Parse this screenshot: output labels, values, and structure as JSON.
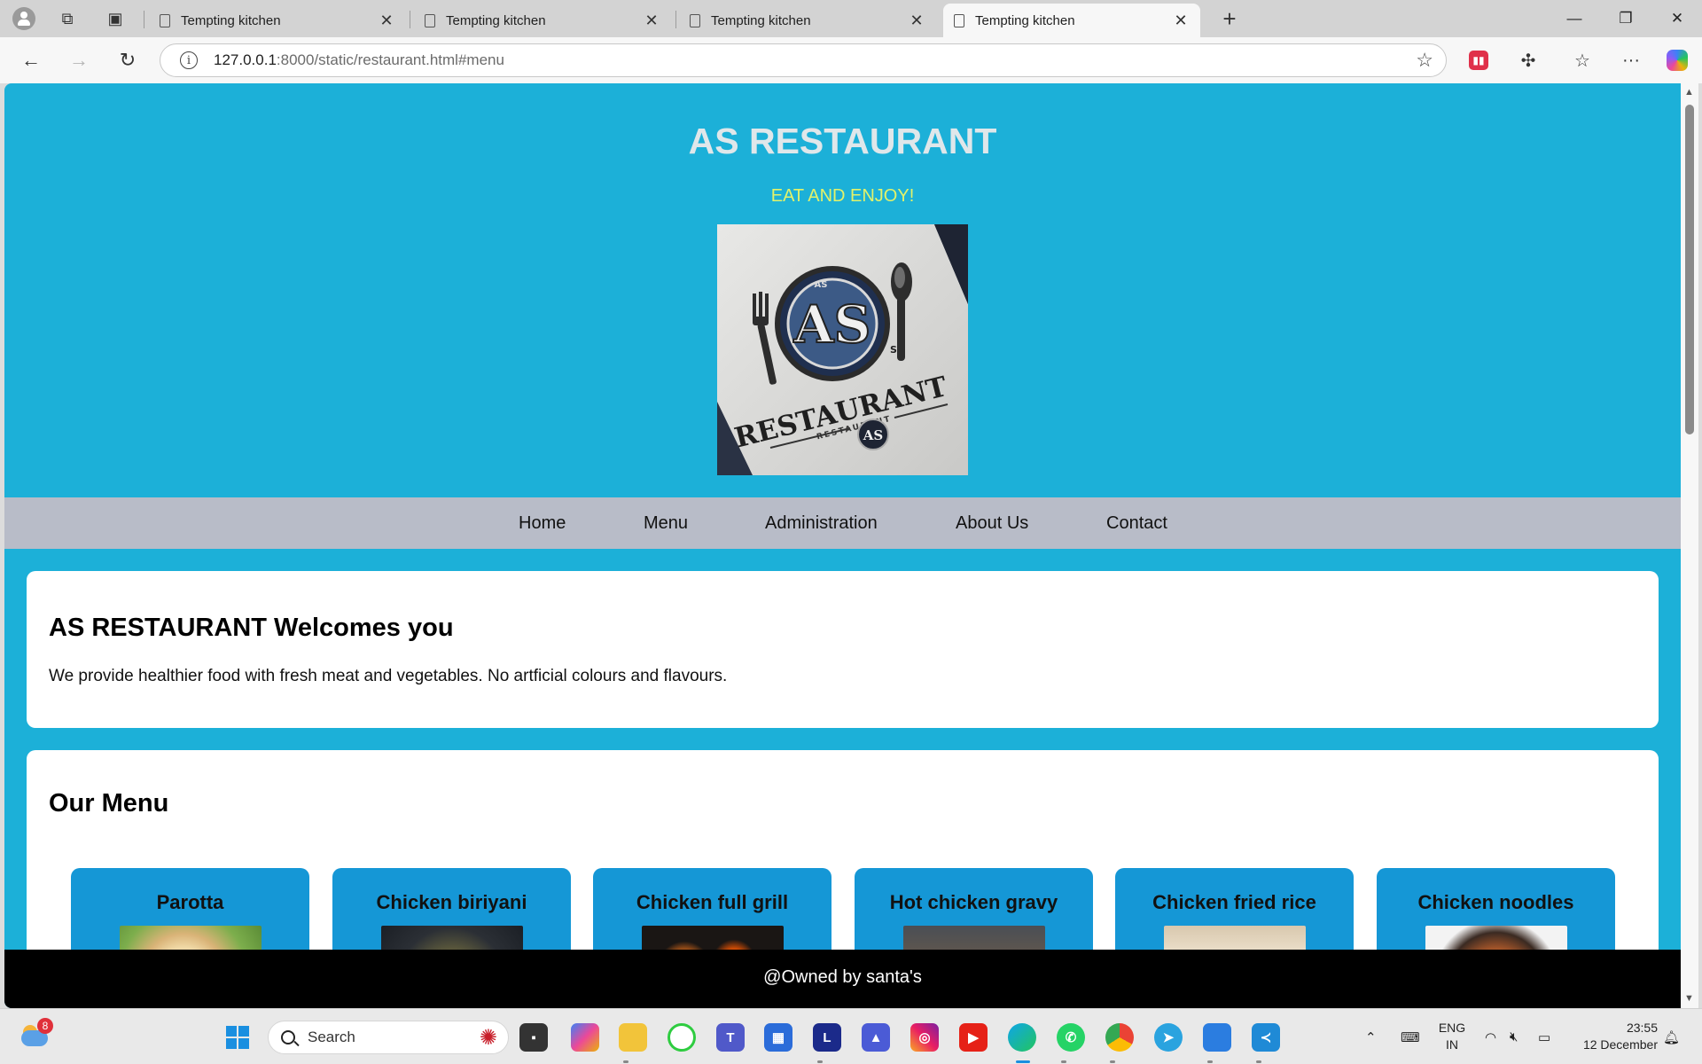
{
  "browser": {
    "tabs": [
      {
        "title": "Tempting kitchen",
        "active": false
      },
      {
        "title": "Tempting kitchen",
        "active": false
      },
      {
        "title": "Tempting kitchen",
        "active": false
      },
      {
        "title": "Tempting kitchen",
        "active": true
      }
    ],
    "url_host": "127.0.0.1",
    "url_rest": ":8000/static/restaurant.html#menu"
  },
  "page": {
    "site_title": "AS RESTAURANT",
    "tagline": "EAT AND ENJOY!",
    "logo": {
      "text_initials": "AS",
      "text_main": "RESTAURANT",
      "text_small": "RESTAURANT",
      "text_top": "AS",
      "text_side": "S"
    },
    "nav": [
      "Home",
      "Menu",
      "Administration",
      "About Us",
      "Contact"
    ],
    "welcome": {
      "heading": "AS RESTAURANT Welcomes you",
      "text": "We provide healthier food with fresh meat and vegetables. No artficial colours and flavours."
    },
    "menu": {
      "heading": "Our Menu",
      "items": [
        "Parotta",
        "Chicken biriyani",
        "Chicken full grill",
        "Hot chicken gravy",
        "Chicken fried rice",
        "Chicken noodles"
      ]
    },
    "footer": "@Owned by santa's"
  },
  "taskbar": {
    "weather_badge": "8",
    "search_placeholder": "Search",
    "lang_line1": "ENG",
    "lang_line2": "IN",
    "time": "23:55",
    "date": "12 December"
  },
  "colors": {
    "page_bg": "#1cb0d8",
    "nav_bg": "#b8bcc8",
    "dish_card": "#1597d6",
    "tagline": "#e2f26a",
    "footer_bg": "#000000"
  }
}
